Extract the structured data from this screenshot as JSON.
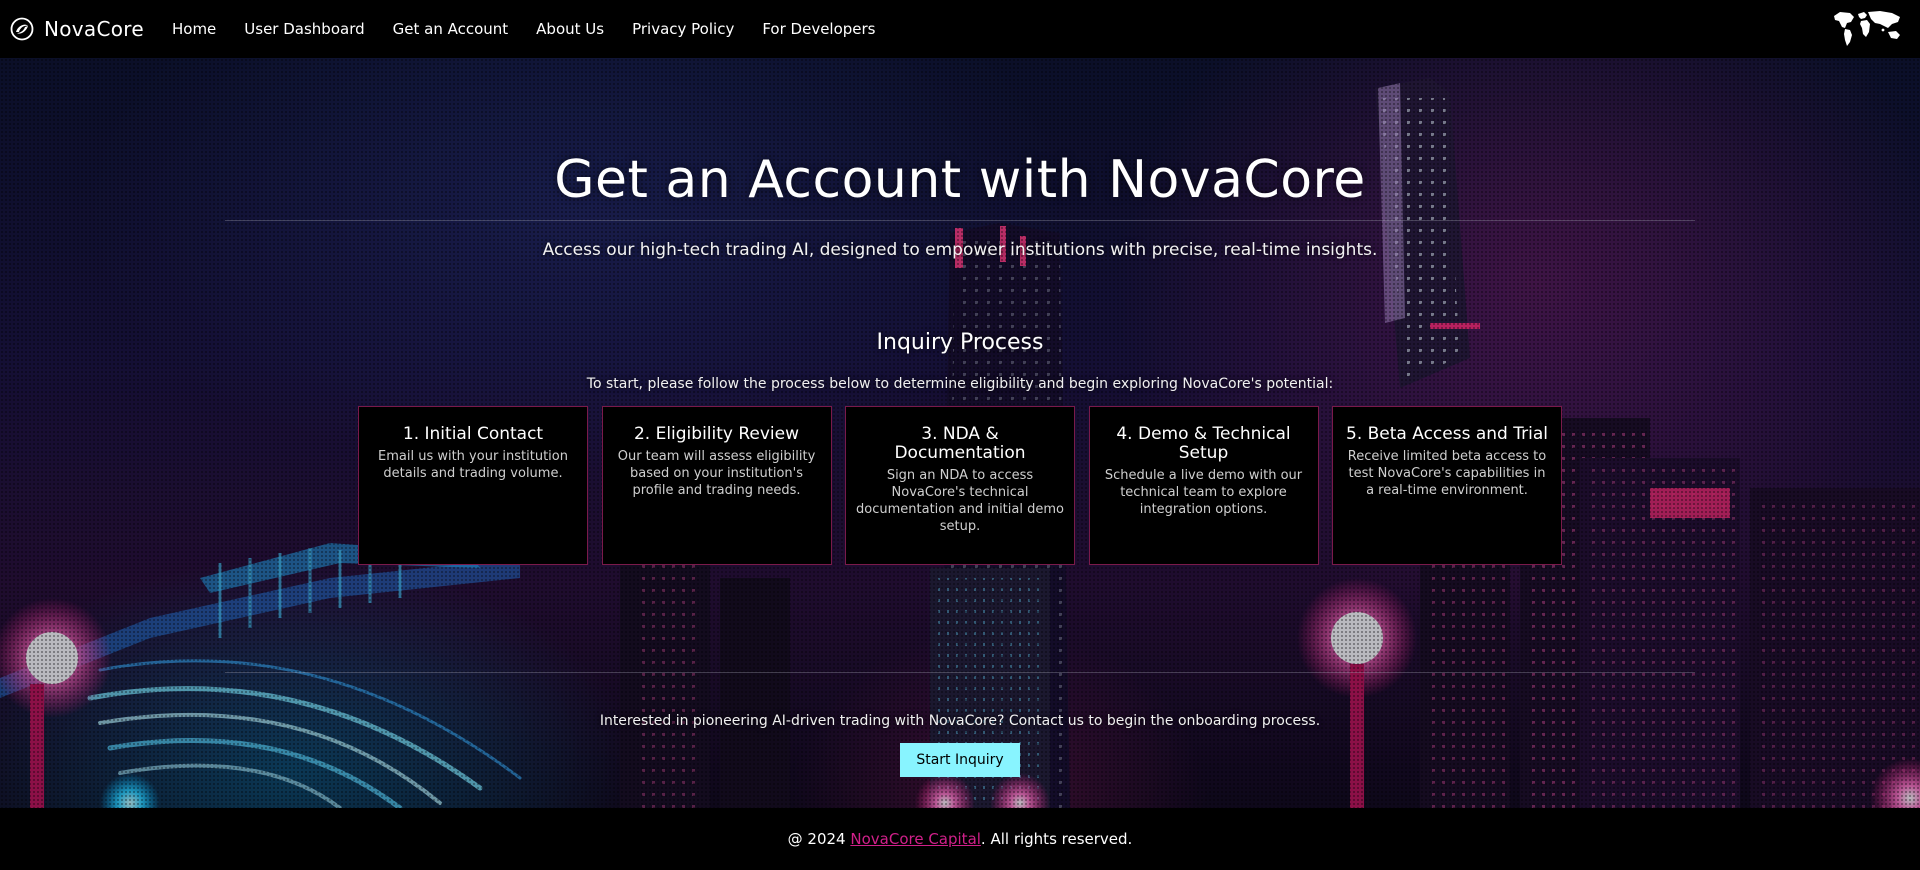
{
  "nav": {
    "brand": "NovaCore",
    "links": [
      "Home",
      "User Dashboard",
      "Get an Account",
      "About Us",
      "Privacy Policy",
      "For Developers"
    ]
  },
  "hero": {
    "title": "Get an Account with NovaCore",
    "subtitle": "Access our high-tech trading AI, designed to empower institutions with precise, real-time insights."
  },
  "inquiry": {
    "title": "Inquiry Process",
    "description": "To start, please follow the process below to determine eligibility and begin exploring NovaCore's potential:",
    "steps": [
      {
        "title": "1. Initial Contact",
        "text": "Email us with your institution details and trading volume."
      },
      {
        "title": "2. Eligibility Review",
        "text": "Our team will assess eligibility based on your institution's profile and trading needs."
      },
      {
        "title": "3. NDA & Documentation",
        "text": "Sign an NDA to access NovaCore's technical documentation and initial demo setup."
      },
      {
        "title": "4. Demo & Technical Setup",
        "text": "Schedule a live demo with our technical team to explore integration options."
      },
      {
        "title": "5. Beta Access and Trial",
        "text": "Receive limited beta access to test NovaCore's capabilities in a real-time environment."
      }
    ]
  },
  "cta": {
    "text": "Interested in pioneering AI-driven trading with NovaCore? Contact us to begin the onboarding process.",
    "button": "Start Inquiry"
  },
  "footer": {
    "prefix": "@ 2024 ",
    "link": "NovaCore Capital",
    "suffix": ". All rights reserved."
  },
  "colors": {
    "accent": "#88f4ff",
    "card_border": "#7a1a4a",
    "footer_link": "#d0208a"
  },
  "icons": {
    "brand": "swirl-logo-icon",
    "globe": "world-map-icon"
  }
}
